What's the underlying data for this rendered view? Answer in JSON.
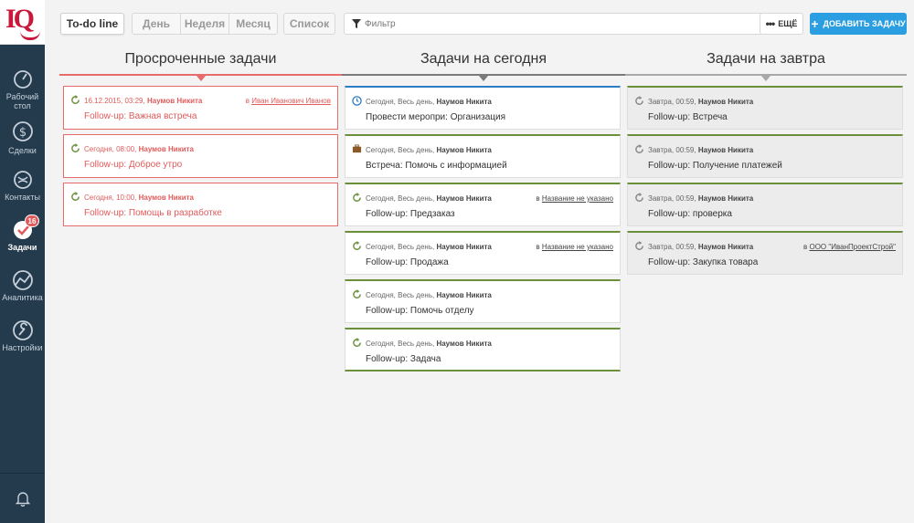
{
  "logo": {
    "text": "IQ"
  },
  "sidebar": {
    "items": [
      {
        "label": "Рабочий стол",
        "icon": "dashboard-icon"
      },
      {
        "label": "Сделки",
        "icon": "dollar-icon"
      },
      {
        "label": "Контакты",
        "icon": "contacts-icon"
      },
      {
        "label": "Задачи",
        "icon": "check-icon",
        "badge": "16"
      },
      {
        "label": "Аналитика",
        "icon": "analytics-icon"
      },
      {
        "label": "Настройки",
        "icon": "wrench-icon"
      }
    ],
    "bell_icon": "bell-icon"
  },
  "toolbar": {
    "todo": "To-do line",
    "day": "День",
    "week": "Неделя",
    "month": "Месяц",
    "list": "Список",
    "filter_placeholder": "Фильтр",
    "more": "ЕЩЁ",
    "add": "ДОБАВИТЬ ЗАДАЧУ"
  },
  "columns": {
    "overdue": {
      "title": "Просроченные задачи",
      "cards": [
        {
          "time": "16.12.2015, 03:29,",
          "user": "Наумов Никита",
          "prefix": "в",
          "link": "Иван Иванович Иванов",
          "title": "Follow-up: Важная встреча"
        },
        {
          "time": "Сегодня, 08:00,",
          "user": "Наумов Никита",
          "prefix": "",
          "link": "",
          "title": "Follow-up: Доброе утро"
        },
        {
          "time": "Сегодня, 10:00,",
          "user": "Наумов Никита",
          "prefix": "",
          "link": "",
          "title": "Follow-up: Помощь в разработке"
        }
      ]
    },
    "today": {
      "title": "Задачи на сегодня",
      "cards": [
        {
          "time": "Сегодня, Весь день,",
          "user": "Наумов Никита",
          "prefix": "",
          "link": "",
          "title": "Провести меропри: Организация",
          "icon": "clock-icon"
        },
        {
          "time": "Сегодня, Весь день,",
          "user": "Наумов Никита",
          "prefix": "",
          "link": "",
          "title": "Встреча: Помочь с информацией",
          "icon": "briefcase-icon"
        },
        {
          "time": "Сегодня, Весь день,",
          "user": "Наумов Никита",
          "prefix": "в",
          "link": "Название не указано",
          "title": "Follow-up: Предзаказ",
          "icon": "refresh-icon"
        },
        {
          "time": "Сегодня, Весь день,",
          "user": "Наумов Никита",
          "prefix": "в",
          "link": "Название не указано",
          "title": "Follow-up: Продажа",
          "icon": "refresh-icon"
        },
        {
          "time": "Сегодня, Весь день,",
          "user": "Наумов Никита",
          "prefix": "",
          "link": "",
          "title": "Follow-up: Помочь отделу",
          "icon": "refresh-icon"
        },
        {
          "time": "Сегодня, Весь день,",
          "user": "Наумов Никита",
          "prefix": "",
          "link": "",
          "title": "Follow-up: Задача",
          "icon": "refresh-icon"
        }
      ]
    },
    "tomorrow": {
      "title": "Задачи на завтра",
      "cards": [
        {
          "time": "Завтра, 00:59,",
          "user": "Наумов Никита",
          "prefix": "",
          "link": "",
          "title": "Follow-up: Встреча"
        },
        {
          "time": "Завтра, 00:59,",
          "user": "Наумов Никита",
          "prefix": "",
          "link": "",
          "title": "Follow-up: Получение платежей"
        },
        {
          "time": "Завтра, 00:59,",
          "user": "Наумов Никита",
          "prefix": "",
          "link": "",
          "title": "Follow-up: проверка"
        },
        {
          "time": "Завтра, 00:59,",
          "user": "Наумов Никита",
          "prefix": "в",
          "link": "ООО \"ИванПроектСтрой\"",
          "title": "Follow-up: Закупка товара"
        }
      ]
    }
  },
  "colors": {
    "sidebar": "#243a4d",
    "accent_red": "#e05b5b",
    "accent_blue": "#2a9ee0",
    "today_green": "#6b8f3a",
    "today_blue": "#2a7cc4"
  }
}
